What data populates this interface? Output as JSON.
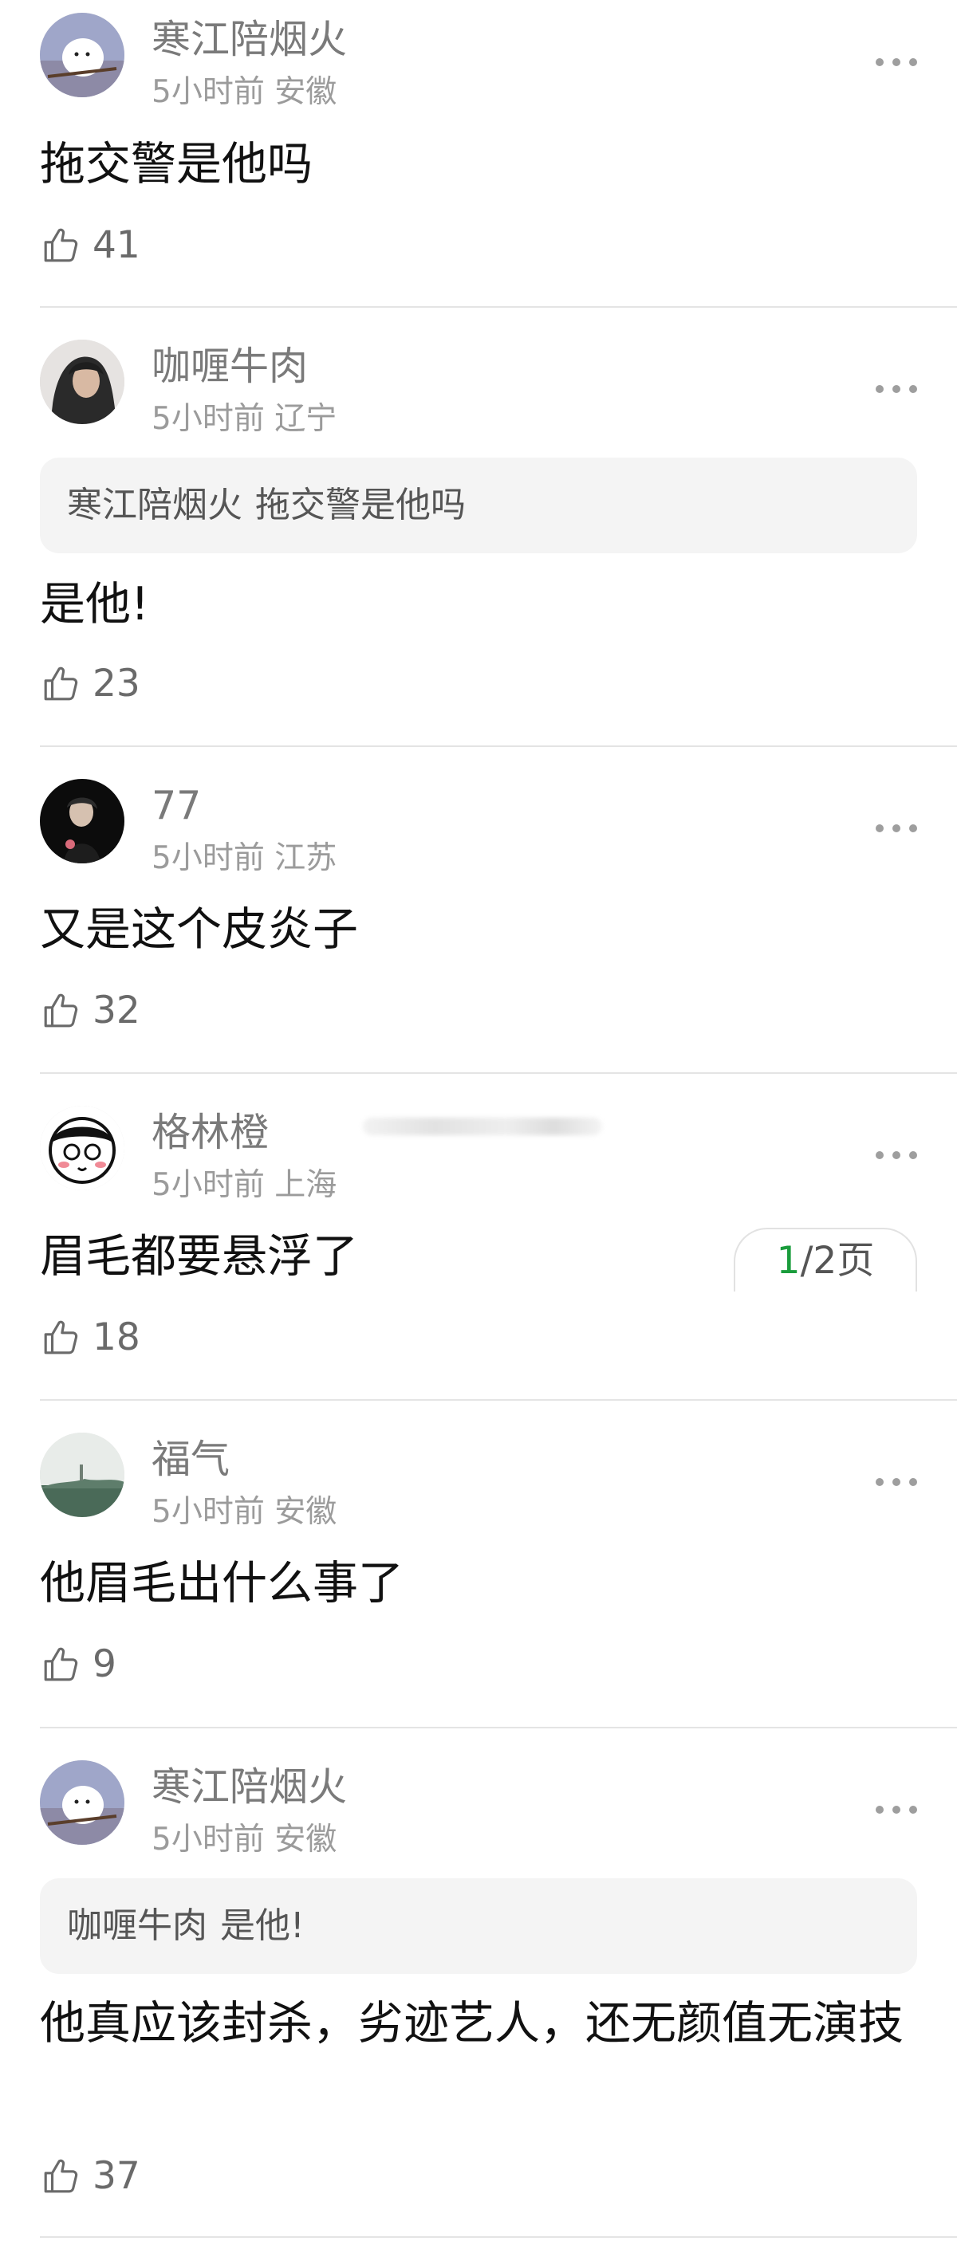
{
  "comments": [
    {
      "username": "寒江陪烟火",
      "time": "5小时前",
      "location": "安徽",
      "text": "拖交警是他吗",
      "likes": "41",
      "avatar_icon": "bird-avatar"
    },
    {
      "username": "咖喱牛肉",
      "time": "5小时前",
      "location": "辽宁",
      "quote_user": "寒江陪烟火",
      "quote_text": "拖交警是他吗",
      "text": "是他!",
      "likes": "23",
      "avatar_icon": "person-avatar"
    },
    {
      "username": "77",
      "time": "5小时前",
      "location": "江苏",
      "text": "又是这个皮炎子",
      "likes": "32",
      "avatar_icon": "dark-portrait-avatar"
    },
    {
      "username": "格林橙",
      "time": "5小时前",
      "location": "上海",
      "text": "眉毛都要悬浮了",
      "likes": "18",
      "avatar_icon": "cartoon-avatar"
    },
    {
      "username": "福气",
      "time": "5小时前",
      "location": "安徽",
      "text": "他眉毛出什么事了",
      "likes": "9",
      "avatar_icon": "landscape-avatar"
    },
    {
      "username": "寒江陪烟火",
      "time": "5小时前",
      "location": "安徽",
      "quote_user": "咖喱牛肉",
      "quote_text": "是他!",
      "text": "他真应该封杀，劣迹艺人，还无颜值无演技",
      "likes": "37",
      "avatar_icon": "bird-avatar"
    }
  ],
  "pager": {
    "current": "1",
    "total_label": "/2页"
  },
  "colors": {
    "page_current": "#1a9c3c",
    "username": "#7a7a7a",
    "meta": "#9b9b9b",
    "quote_bg": "#f4f4f4"
  }
}
